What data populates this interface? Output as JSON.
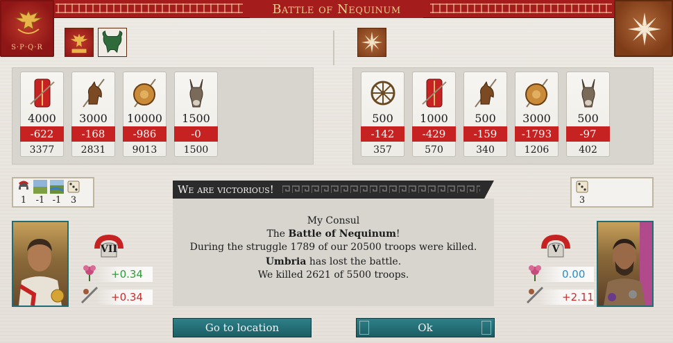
{
  "title": "Battle of Nequinum",
  "left_emblem": {
    "text": "S·P·Q·R"
  },
  "left_side": {
    "units": [
      {
        "icon": "legionary-shield-icon",
        "count": "4000",
        "loss": "-622",
        "remaining": "3377"
      },
      {
        "icon": "cavalry-horse-icon",
        "count": "3000",
        "loss": "-168",
        "remaining": "2831"
      },
      {
        "icon": "hoplite-shield-icon",
        "count": "10000",
        "loss": "-986",
        "remaining": "9013"
      },
      {
        "icon": "supply-donkey-icon",
        "count": "1500",
        "loss": "-0",
        "remaining": "1500"
      }
    ],
    "modifiers": [
      "1",
      "-1",
      "-1",
      "3"
    ],
    "commander_rank": "VII",
    "trait_values": [
      "+0.34",
      "+0.34"
    ]
  },
  "right_side": {
    "units": [
      {
        "icon": "chariot-wheel-icon",
        "count": "500",
        "loss": "-142",
        "remaining": "357"
      },
      {
        "icon": "legionary-shield-icon",
        "count": "1000",
        "loss": "-429",
        "remaining": "570"
      },
      {
        "icon": "cavalry-horse-icon",
        "count": "500",
        "loss": "-159",
        "remaining": "340"
      },
      {
        "icon": "hoplite-shield-icon",
        "count": "3000",
        "loss": "-1793",
        "remaining": "1206"
      },
      {
        "icon": "supply-donkey-icon",
        "count": "500",
        "loss": "-97",
        "remaining": "402"
      }
    ],
    "modifiers": [
      "3"
    ],
    "commander_rank": "V",
    "trait_values": [
      "0.00",
      "+2.11"
    ]
  },
  "message": {
    "header": "We are victorious!",
    "greeting": "My Consul",
    "line1_prefix": "The ",
    "line1_bold": "Battle of Nequinum",
    "line1_suffix": "!",
    "line2": "During the struggle 1789 of our 20500 troops were killed.",
    "line3_bold": "Umbria",
    "line3_suffix": " has lost the battle.",
    "line4": "We killed 2621 of 5500 troops."
  },
  "buttons": {
    "go_to_location": "Go to location",
    "ok": "Ok"
  },
  "colors": {
    "loss_red": "#c62222",
    "positive_green": "#2f9a3a",
    "negative_red": "#c23030",
    "neutral_blue": "#1f8fd0",
    "teal": "#1e6d74"
  }
}
